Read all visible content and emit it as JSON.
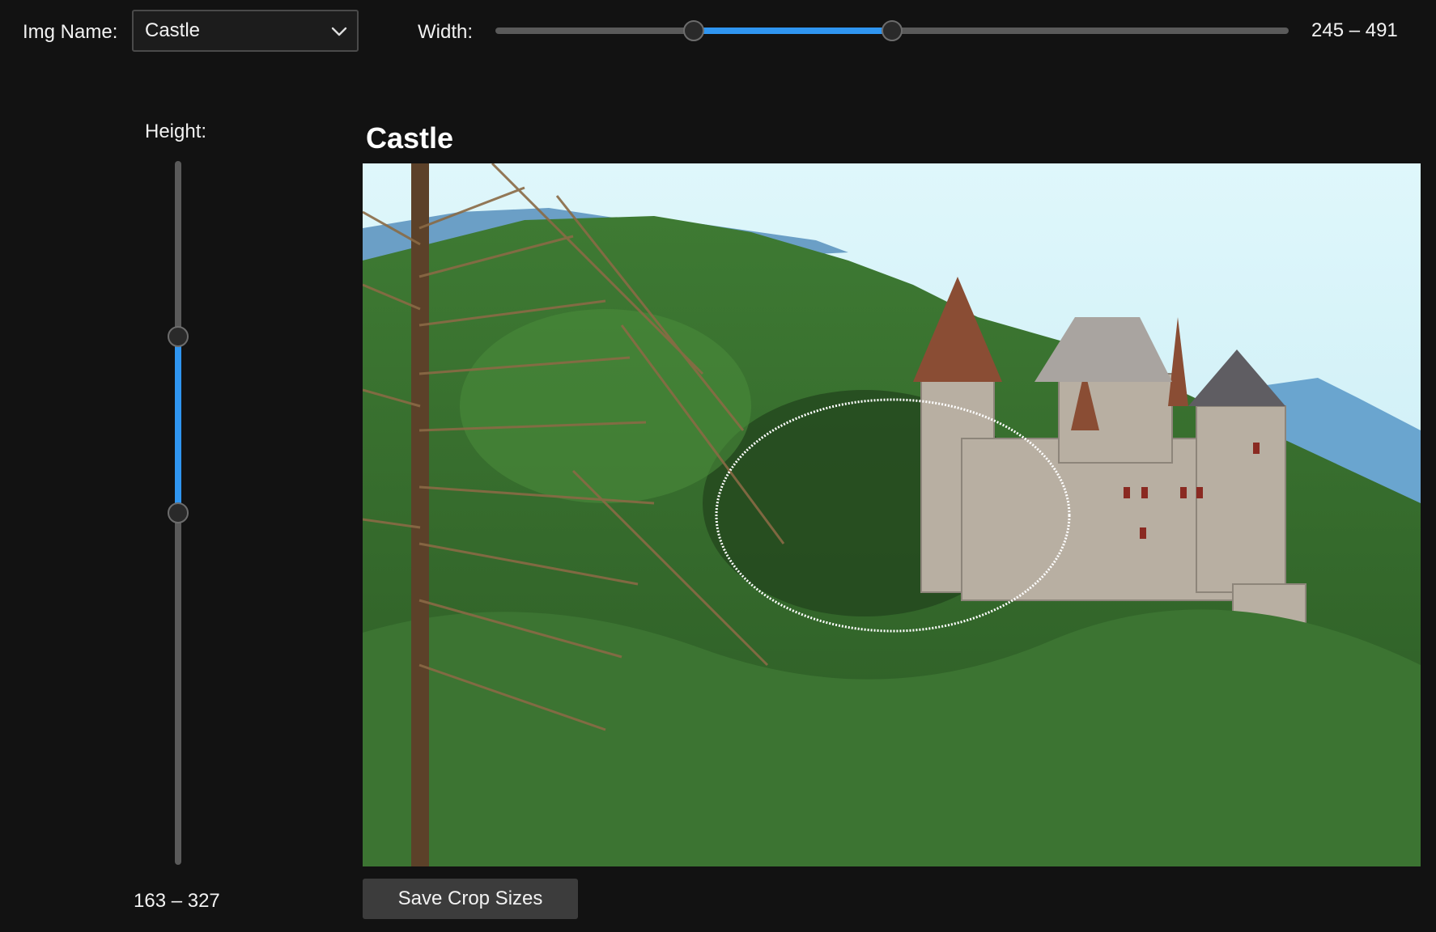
{
  "toolbar": {
    "img_name_label": "Img Name:",
    "img_name_selected": "Castle",
    "width_label": "Width:",
    "width_range": {
      "min": 0,
      "max": 981,
      "low": 245,
      "high": 491
    },
    "width_readout": "245 – 491"
  },
  "height_slider": {
    "label": "Height:",
    "range": {
      "min": 0,
      "max": 654,
      "low": 163,
      "high": 327
    },
    "readout": "163 – 327"
  },
  "panel": {
    "title": "Castle"
  },
  "actions": {
    "save_label": "Save Crop Sizes"
  },
  "colors": {
    "accent": "#2f95f0",
    "background": "#121212",
    "track": "#5a5a5a",
    "crop_outline": "#ffffff"
  },
  "icons": {
    "select_chevron": "chevron-down-icon"
  }
}
